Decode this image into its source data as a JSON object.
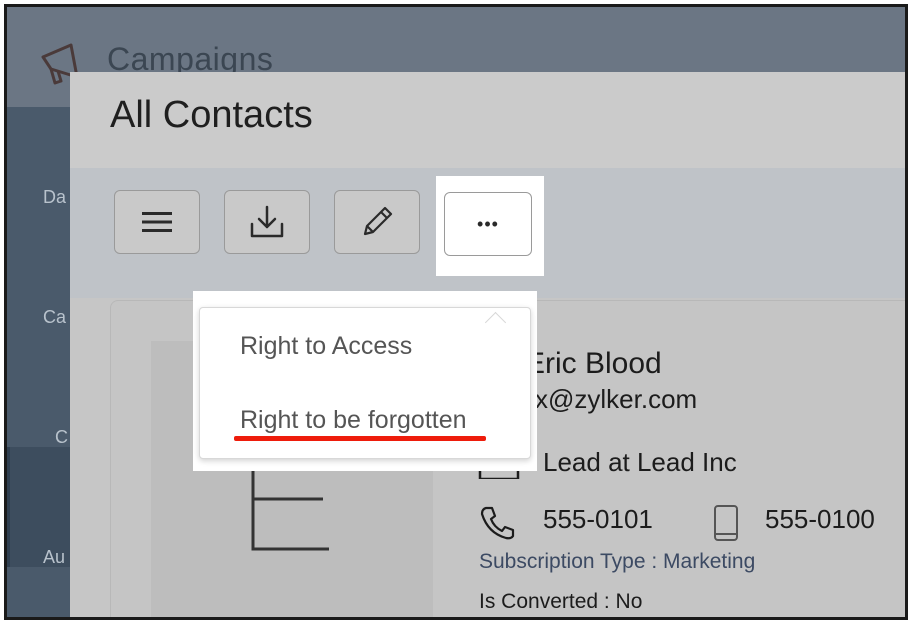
{
  "app": {
    "title": "Campaigns",
    "sidebar": [
      {
        "label": "Da"
      },
      {
        "label": "Ca"
      },
      {
        "label": "C"
      },
      {
        "label": "Au"
      }
    ]
  },
  "panel": {
    "title": "All Contacts"
  },
  "toolbar": {
    "buttons": [
      {
        "icon": "menu-icon"
      },
      {
        "icon": "download-icon"
      },
      {
        "icon": "pencil-icon"
      },
      {
        "icon": "more-icon",
        "label": "•••"
      }
    ]
  },
  "dropdown": {
    "items": [
      {
        "label": "Right to Access"
      },
      {
        "label": "Right to be forgotten"
      }
    ],
    "highlight_color": "#ee1c0b"
  },
  "contact": {
    "avatar_letter": "E",
    "name": "Eric Blood",
    "email": "x@zylker.com",
    "company": "Lead at Lead Inc",
    "phone": "555-0101",
    "mobile": "555-0100",
    "subscription_type": "Subscription Type : Marketing",
    "is_converted": "Is Converted : No"
  }
}
